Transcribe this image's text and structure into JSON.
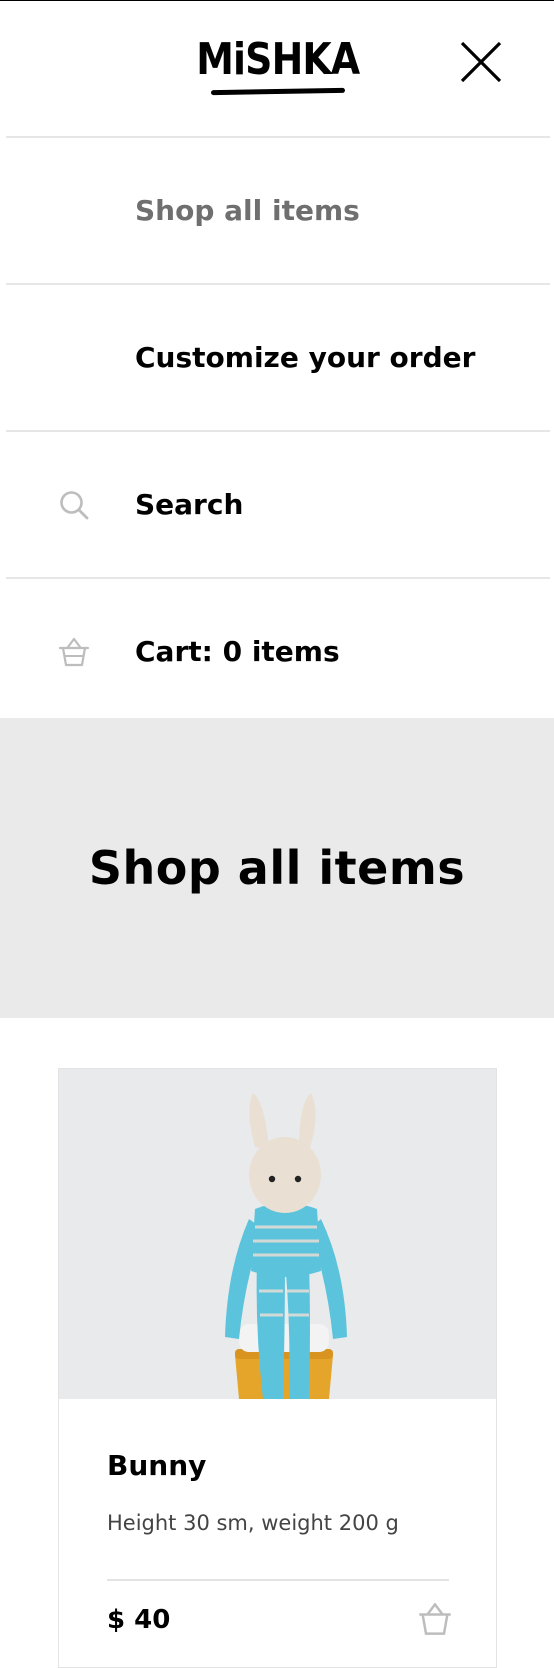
{
  "header": {
    "logo_text": "MiSHKA"
  },
  "menu": {
    "items": [
      {
        "label": "Shop all items",
        "icon": null,
        "active": true
      },
      {
        "label": "Customize your order",
        "icon": null,
        "active": false
      },
      {
        "label": "Search",
        "icon": "search-icon",
        "active": false
      },
      {
        "label": "Cart: 0 items",
        "icon": "basket-icon",
        "active": false
      }
    ]
  },
  "hero": {
    "title": "Shop all items"
  },
  "product": {
    "name": "Bunny",
    "description": "Height 30 sm, weight 200 g",
    "price": "$ 40"
  },
  "colors": {
    "active_menu_text": "#6f6f6f",
    "hero_background": "#eaeaea",
    "divider": "#e6e6e6",
    "toy_blue": "#5cc3dc",
    "toy_beige": "#e9dfd2",
    "stand_orange": "#e5a52a"
  }
}
